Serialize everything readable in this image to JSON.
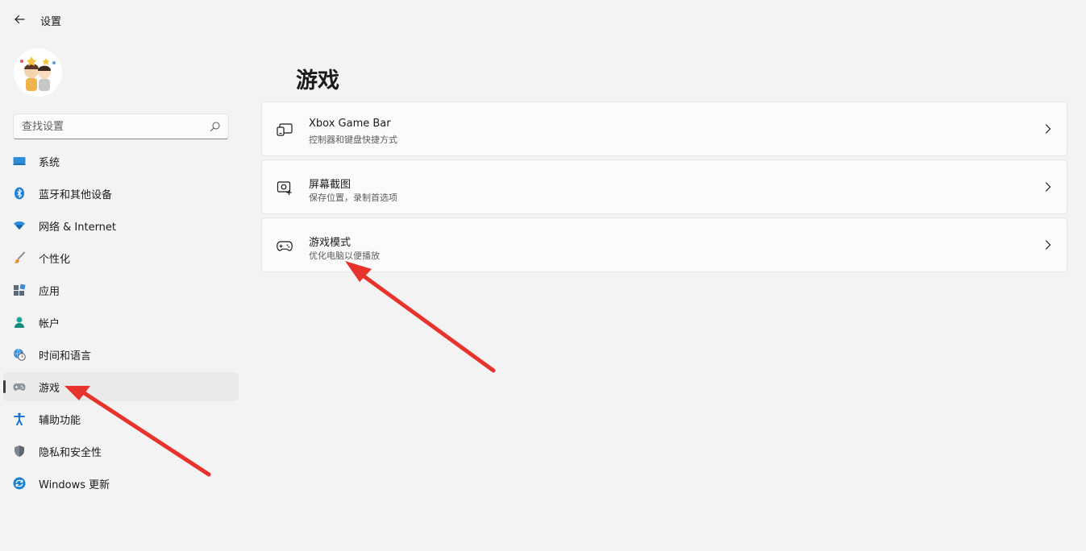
{
  "window": {
    "title": "设置"
  },
  "search": {
    "placeholder": "查找设置"
  },
  "sidebar": {
    "items": [
      {
        "label": "系统",
        "icon": "monitor-icon"
      },
      {
        "label": "蓝牙和其他设备",
        "icon": "bluetooth-icon"
      },
      {
        "label": "网络 & Internet",
        "icon": "wifi-icon"
      },
      {
        "label": "个性化",
        "icon": "brush-icon"
      },
      {
        "label": "应用",
        "icon": "apps-icon"
      },
      {
        "label": "帐户",
        "icon": "person-icon"
      },
      {
        "label": "时间和语言",
        "icon": "globe-clock-icon"
      },
      {
        "label": "游戏",
        "icon": "gamepad-icon",
        "selected": true
      },
      {
        "label": "辅助功能",
        "icon": "accessibility-icon"
      },
      {
        "label": "隐私和安全性",
        "icon": "shield-icon"
      },
      {
        "label": "Windows 更新",
        "icon": "update-icon"
      }
    ]
  },
  "main": {
    "title": "游戏",
    "cards": [
      {
        "title": "Xbox Game Bar",
        "subtitle": "控制器和键盘快捷方式",
        "icon": "game-bar-icon"
      },
      {
        "title": "屏幕截图",
        "subtitle": "保存位置，录制首选项",
        "icon": "capture-icon"
      },
      {
        "title": "游戏模式",
        "subtitle": "优化电脑以便播放",
        "icon": "game-mode-icon"
      }
    ]
  },
  "colors": {
    "arrow": "#e8322c",
    "background": "#f3f3f3",
    "card": "#fbfbfb",
    "accent": "#0067c0"
  }
}
